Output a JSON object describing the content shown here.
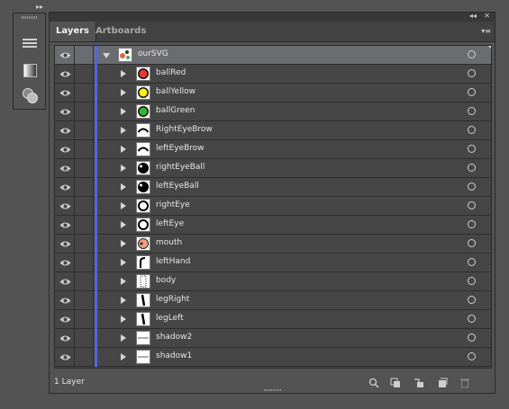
{
  "tabs": [
    {
      "label": "Layers",
      "active": true
    },
    {
      "label": "Artboards",
      "active": false
    }
  ],
  "parent_layer": {
    "name": "ourSVG",
    "expanded": true
  },
  "layers": [
    {
      "name": "ballRed",
      "thumb": "red-ball"
    },
    {
      "name": "ballYellow",
      "thumb": "yellow-ball"
    },
    {
      "name": "ballGreen",
      "thumb": "green-ball"
    },
    {
      "name": "RightEyeBrow",
      "thumb": "brow"
    },
    {
      "name": "leftEyeBrow",
      "thumb": "brow"
    },
    {
      "name": "rightEyeBall",
      "thumb": "eyeball"
    },
    {
      "name": "leftEyeBall",
      "thumb": "eyeball"
    },
    {
      "name": "rightEye",
      "thumb": "eye-ring"
    },
    {
      "name": "leftEye",
      "thumb": "eye-ring"
    },
    {
      "name": "mouth",
      "thumb": "mouth"
    },
    {
      "name": "leftHand",
      "thumb": "hand"
    },
    {
      "name": "body",
      "thumb": "body"
    },
    {
      "name": "legRight",
      "thumb": "leg"
    },
    {
      "name": "legLeft",
      "thumb": "leg"
    },
    {
      "name": "shadow2",
      "thumb": "shadow"
    },
    {
      "name": "shadow1",
      "thumb": "shadow"
    }
  ],
  "status": {
    "layer_count": "1 Layer"
  },
  "colors": {
    "layer_color": "#4f68d8",
    "panel_bg": "#535353",
    "list_bg": "#464646",
    "selected_row": "#6a6c70"
  },
  "icons": {
    "visibility": "eye-icon",
    "expand": "disclosure-triangle-icon",
    "target": "target-circle-icon",
    "status_bar": [
      "locate-object-icon",
      "make-clipping-mask-icon",
      "create-sublayer-icon",
      "create-new-layer-icon",
      "delete-layer-icon"
    ]
  }
}
